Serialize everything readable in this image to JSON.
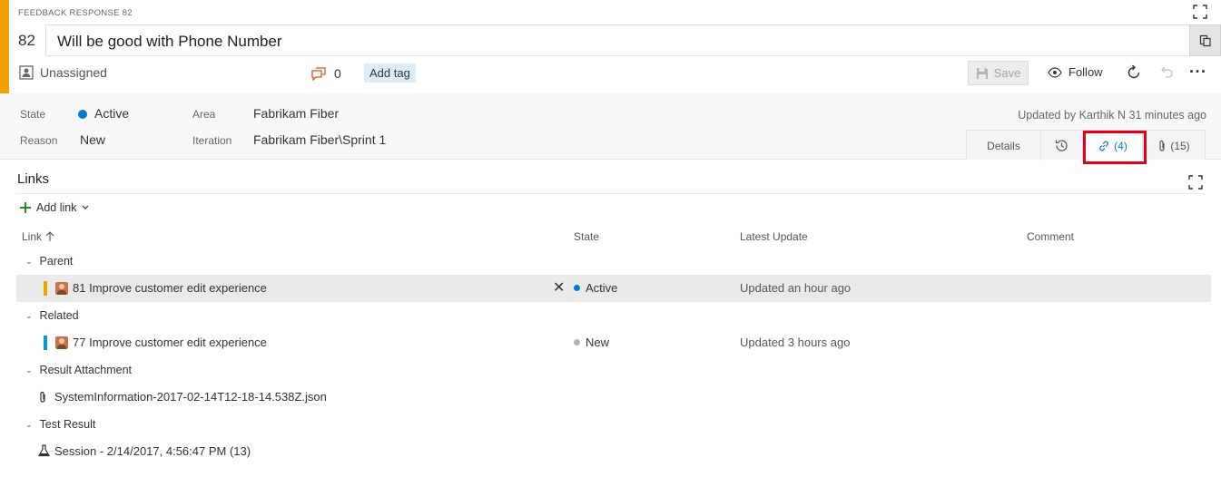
{
  "header": {
    "work_item_type": "FEEDBACK RESPONSE 82",
    "id": "82",
    "title": "Will be good with Phone Number",
    "assignee": "Unassigned",
    "comment_count": "0",
    "add_tag_label": "Add tag",
    "save_label": "Save",
    "follow_label": "Follow",
    "accent_color": "#f2a100"
  },
  "fields": {
    "state_label": "State",
    "state_value": "Active",
    "reason_label": "Reason",
    "reason_value": "New",
    "area_label": "Area",
    "area_value": "Fabrikam Fiber",
    "iteration_label": "Iteration",
    "iteration_value": "Fabrikam Fiber\\Sprint 1",
    "updated_by": "Updated by Karthik N 31 minutes ago"
  },
  "tabs": {
    "details": "Details",
    "links": "(4)",
    "attachments": "(15)"
  },
  "links": {
    "heading": "Links",
    "add_link_label": "Add link",
    "columns": {
      "link": "Link",
      "state": "State",
      "latest_update": "Latest Update",
      "comment": "Comment"
    },
    "groups": [
      {
        "name": "Parent",
        "items": [
          {
            "id": "81",
            "title": "Improve customer edit experience",
            "state": "Active",
            "state_color": "#007acc",
            "strip_color": "#f2a100",
            "latest_update": "Updated an hour ago"
          }
        ]
      },
      {
        "name": "Related",
        "items": [
          {
            "id": "77",
            "title": "Improve customer edit experience",
            "state": "New",
            "state_color": "#b2b2b2",
            "strip_color": "#009ccc",
            "latest_update": "Updated 3 hours ago"
          }
        ]
      },
      {
        "name": "Result Attachment",
        "items": [
          {
            "title": "SystemInformation-2017-02-14T12-18-14.538Z.json",
            "icon": "paperclip-icon"
          }
        ]
      },
      {
        "name": "Test Result",
        "items": [
          {
            "title": "Session - 2/14/2017, 4:56:47 PM (13)",
            "icon": "beaker-icon"
          }
        ]
      }
    ]
  }
}
